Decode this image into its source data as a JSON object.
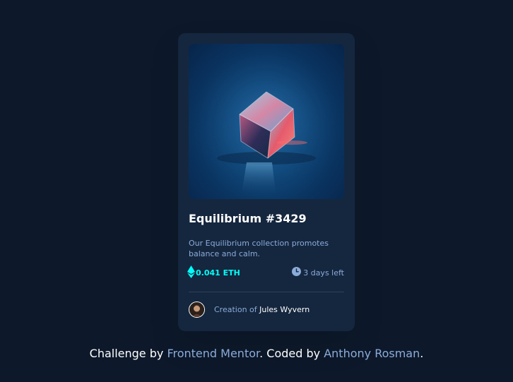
{
  "card": {
    "image_alt": "Equilibrium",
    "title": "Equilibrium #3429",
    "description": "Our Equilibrium collection promotes balance and calm.",
    "price": "0.041 ETH",
    "time_left": "3 days left",
    "creator_prefix": "Creation of ",
    "creator_name": "Jules Wyvern"
  },
  "footer": {
    "prefix": "Challenge by ",
    "challenge_link": "Frontend Mentor",
    "middle": ". Coded by ",
    "author_link": "Anthony Rosman",
    "suffix": "."
  },
  "colors": {
    "page_bg": "#0d192b",
    "card_bg": "#15263f",
    "accent_cyan": "#00fff8",
    "soft_blue": "#8bacd9",
    "white": "#ffffff",
    "divider": "#2e405a"
  },
  "icons": {
    "price": "ethereum-icon",
    "time": "clock-icon"
  }
}
